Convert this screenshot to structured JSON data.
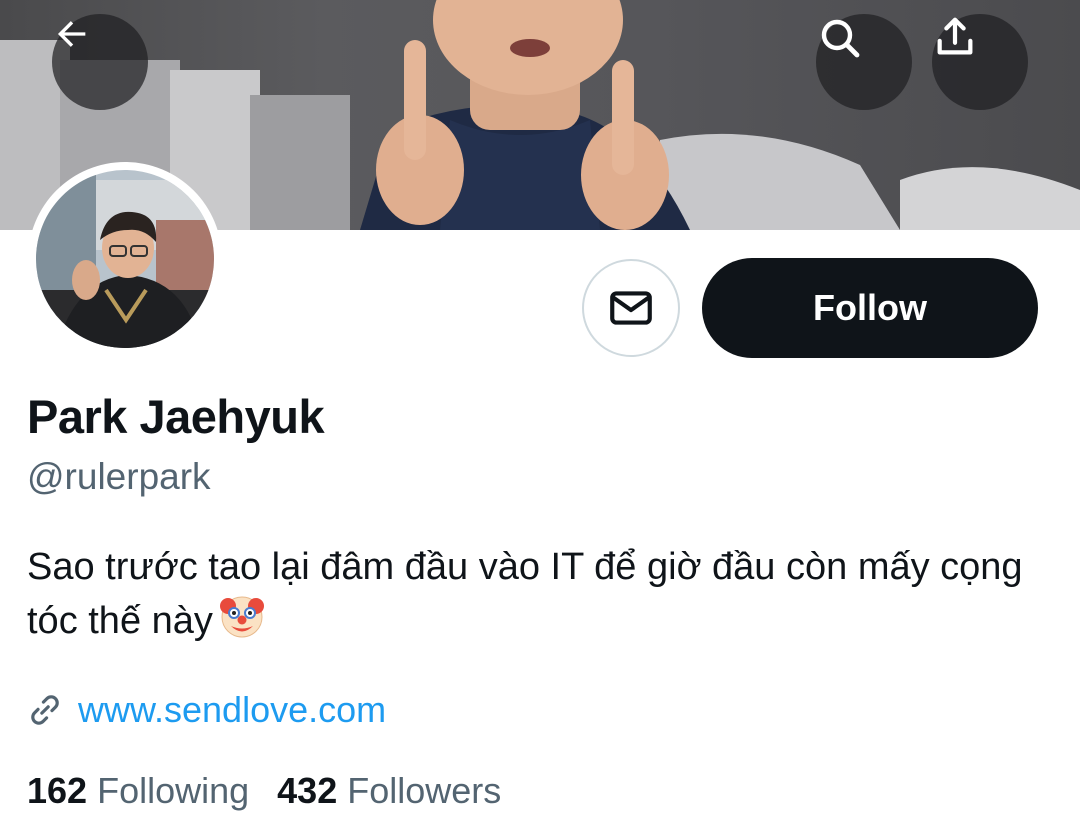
{
  "profile": {
    "name": "Park Jaehyuk",
    "handle": "@rulerpark",
    "bio": "Sao trước tao lại đâm đầu vào IT để giờ đầu còn mấy cọng tóc thế này",
    "bio_emoji": "clown-face-emoji",
    "website": "www.sendlove.com"
  },
  "actions": {
    "follow_label": "Follow",
    "message_icon": "mail-icon"
  },
  "header": {
    "back_icon": "arrow-left-icon",
    "search_icon": "search-icon",
    "share_icon": "share-icon"
  },
  "stats": {
    "following_count": "162",
    "following_label": "Following",
    "followers_count": "432",
    "followers_label": "Followers"
  },
  "colors": {
    "link": "#1d9bf0",
    "primary_text": "#0f1419",
    "secondary_text": "#536471",
    "follow_button_bg": "#0f1419"
  }
}
